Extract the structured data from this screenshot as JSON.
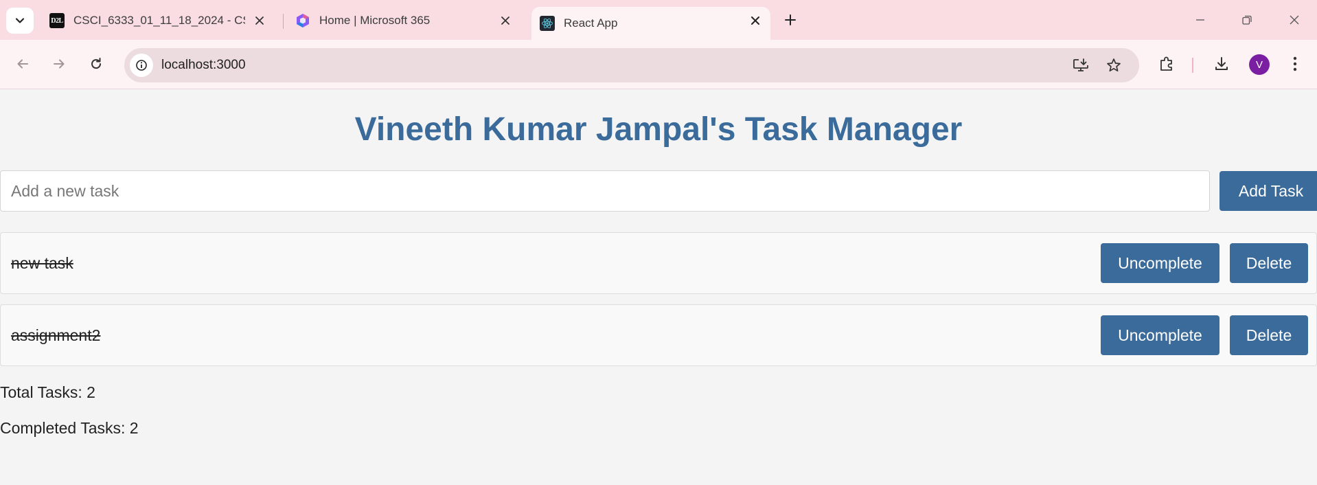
{
  "browser": {
    "tabs": [
      {
        "title": "CSCI_6333_01_11_18_2024 - CS(",
        "favicon": "d2l-icon",
        "favicon_text": "D2L",
        "active": false
      },
      {
        "title": "Home | Microsoft 365",
        "favicon": "microsoft-365-icon",
        "active": false
      },
      {
        "title": "React App",
        "favicon": "react-icon",
        "active": true
      }
    ],
    "url": "localhost:3000",
    "profile_initial": "V"
  },
  "app": {
    "title": "Vineeth Kumar Jampal's Task Manager",
    "input_placeholder": "Add a new task",
    "input_value": "",
    "add_button_label": "Add Task",
    "tasks": [
      {
        "text": "new task",
        "completed": true,
        "toggle_label": "Uncomplete",
        "delete_label": "Delete"
      },
      {
        "text": "assignment2",
        "completed": true,
        "toggle_label": "Uncomplete",
        "delete_label": "Delete"
      }
    ],
    "total_tasks_text": "Total Tasks: 2",
    "completed_tasks_text": "Completed Tasks: 2"
  },
  "colors": {
    "accent": "#3a6b9a",
    "tabstrip": "#f9dde3",
    "toolbar": "#fdf2f4",
    "avatar": "#7b1fa2"
  }
}
